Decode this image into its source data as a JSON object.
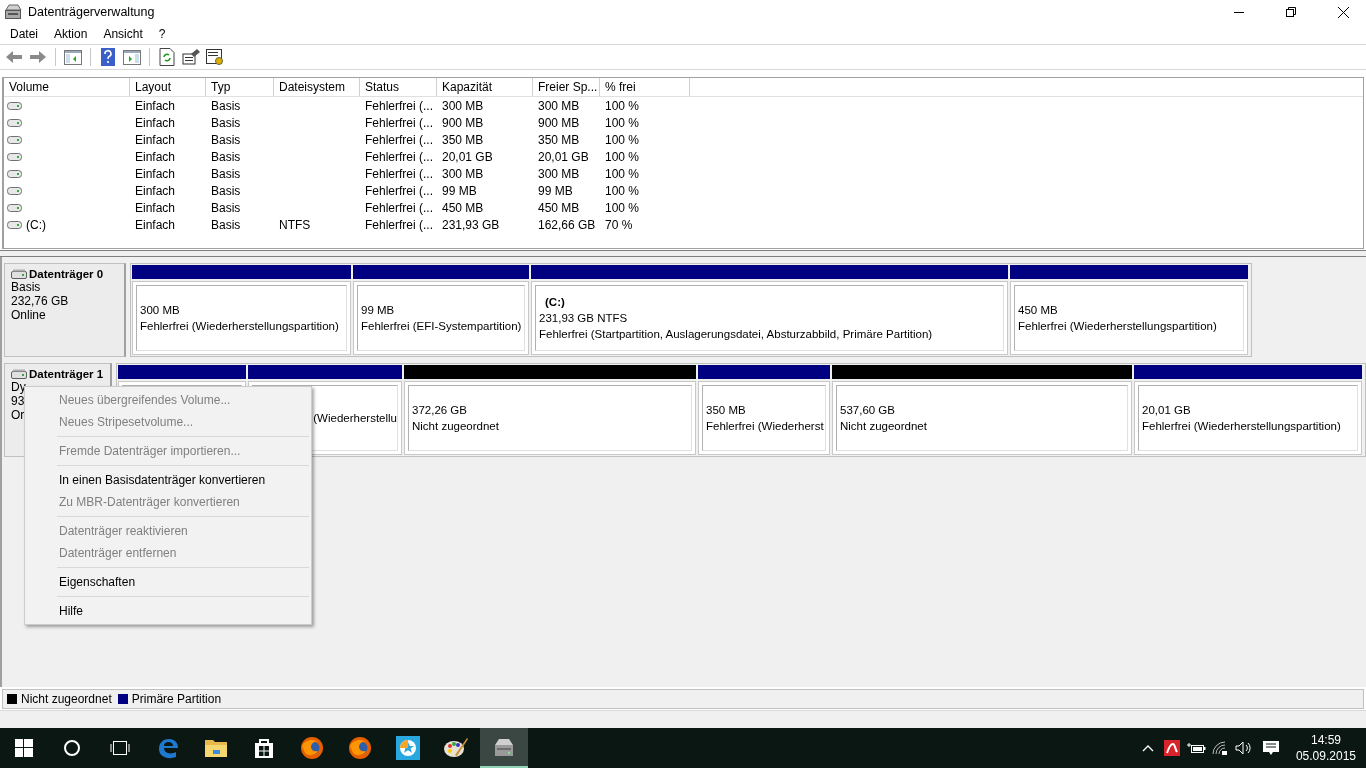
{
  "window": {
    "title": "Datenträgerverwaltung"
  },
  "menu_bar": [
    "Datei",
    "Aktion",
    "Ansicht",
    "?"
  ],
  "volume_table": {
    "columns": [
      "Volume",
      "Layout",
      "Typ",
      "Dateisystem",
      "Status",
      "Kapazität",
      "Freier Sp...",
      "% frei"
    ],
    "rows": [
      {
        "layout": "Einfach",
        "type": "Basis",
        "status": "Fehlerfrei (...",
        "capacity": "300 MB",
        "free": "300 MB",
        "percent_free": "100 %"
      },
      {
        "layout": "Einfach",
        "type": "Basis",
        "status": "Fehlerfrei (...",
        "capacity": "900 MB",
        "free": "900 MB",
        "percent_free": "100 %"
      },
      {
        "layout": "Einfach",
        "type": "Basis",
        "status": "Fehlerfrei (...",
        "capacity": "350 MB",
        "free": "350 MB",
        "percent_free": "100 %"
      },
      {
        "layout": "Einfach",
        "type": "Basis",
        "status": "Fehlerfrei (...",
        "capacity": "20,01 GB",
        "free": "20,01 GB",
        "percent_free": "100 %"
      },
      {
        "layout": "Einfach",
        "type": "Basis",
        "status": "Fehlerfrei (...",
        "capacity": "300 MB",
        "free": "300 MB",
        "percent_free": "100 %"
      },
      {
        "layout": "Einfach",
        "type": "Basis",
        "status": "Fehlerfrei (...",
        "capacity": "99 MB",
        "free": "99 MB",
        "percent_free": "100 %"
      },
      {
        "layout": "Einfach",
        "type": "Basis",
        "status": "Fehlerfrei (...",
        "capacity": "450 MB",
        "free": "450 MB",
        "percent_free": "100 %"
      },
      {
        "volume": "(C:)",
        "layout": "Einfach",
        "type": "Basis",
        "file_system": "NTFS",
        "status": "Fehlerfrei (...",
        "capacity": "231,93 GB",
        "free": "162,66 GB",
        "percent_free": "70 %"
      }
    ]
  },
  "disks": [
    {
      "name": "Datenträger 0",
      "info": [
        "Basis",
        "232,76 GB",
        "Online"
      ],
      "partitions": [
        {
          "kind": "primary",
          "size": "300 MB",
          "status": "Fehlerfrei (Wiederherstellungspartition)"
        },
        {
          "kind": "primary",
          "size": "99 MB",
          "status": "Fehlerfrei (EFI-Systempartition)"
        },
        {
          "kind": "primary",
          "label": "(C:)",
          "size": "231,93 GB NTFS",
          "status": "Fehlerfrei (Startpartition, Auslagerungsdatei, Absturzabbild, Primäre Partition)"
        },
        {
          "kind": "primary",
          "size": "450 MB",
          "status": "Fehlerfrei (Wiederherstellungspartition)"
        }
      ]
    },
    {
      "name": "Datenträger 1",
      "info": [
        "Dy",
        "93",
        "Or"
      ],
      "partitions": [
        {
          "kind": "primary"
        },
        {
          "kind": "primary",
          "status": "(Wiederherstellu"
        },
        {
          "kind": "unallocated",
          "size": "372,26 GB",
          "status": "Nicht zugeordnet"
        },
        {
          "kind": "primary",
          "size": "350 MB",
          "status": "Fehlerfrei (Wiederherst"
        },
        {
          "kind": "unallocated",
          "size": "537,60 GB",
          "status": "Nicht zugeordnet"
        },
        {
          "kind": "primary",
          "size": "20,01 GB",
          "status": "Fehlerfrei (Wiederherstellungspartition)"
        }
      ]
    }
  ],
  "context_menu": {
    "groups": [
      [
        {
          "label": "Neues übergreifendes Volume...",
          "disabled": true
        },
        {
          "label": "Neues Stripesetvolume...",
          "disabled": true
        }
      ],
      [
        {
          "label": "Fremde Datenträger importieren...",
          "disabled": true
        }
      ],
      [
        {
          "label": "In einen Basisdatenträger konvertieren",
          "disabled": false
        },
        {
          "label": "Zu MBR-Datenträger konvertieren",
          "disabled": true
        }
      ],
      [
        {
          "label": "Datenträger reaktivieren",
          "disabled": true
        },
        {
          "label": "Datenträger entfernen",
          "disabled": true
        }
      ],
      [
        {
          "label": "Eigenschaften",
          "disabled": false
        }
      ],
      [
        {
          "label": "Hilfe",
          "disabled": false
        }
      ]
    ]
  },
  "legend": [
    {
      "label": "Nicht zugeordnet",
      "color": "#000000"
    },
    {
      "label": "Primäre Partition",
      "color": "#000080"
    }
  ],
  "taskbar": {
    "apps": [
      {
        "kind": "edge",
        "selected": false
      },
      {
        "kind": "folder",
        "selected": false
      },
      {
        "kind": "store",
        "selected": false
      },
      {
        "kind": "firefox",
        "selected": false
      },
      {
        "kind": "firefox",
        "selected": false
      },
      {
        "kind": "star",
        "selected": false
      },
      {
        "kind": "paint",
        "selected": false
      },
      {
        "kind": "disk",
        "selected": true
      }
    ],
    "time": "14:59",
    "date": "05.09.2015"
  }
}
